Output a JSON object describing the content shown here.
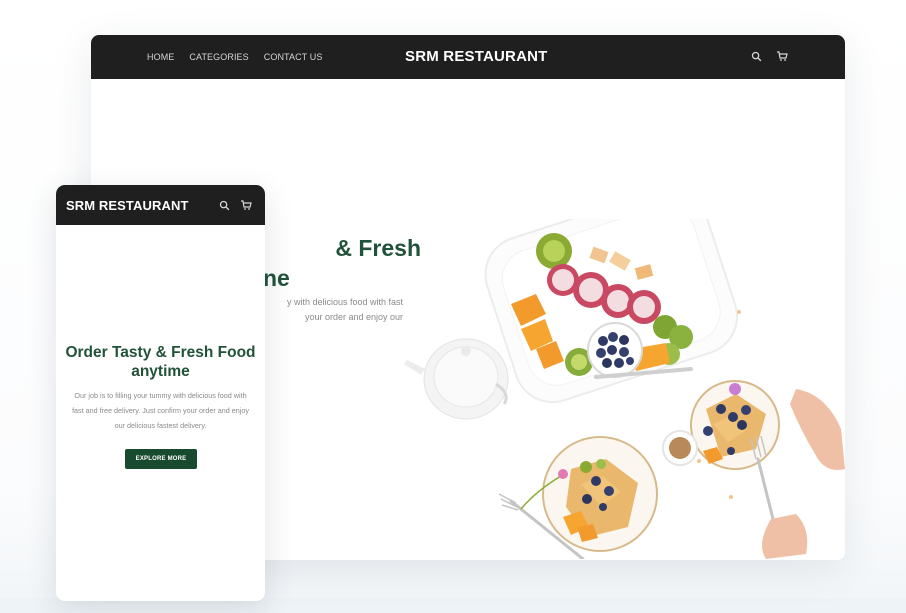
{
  "desktop": {
    "nav": {
      "links": [
        "HOME",
        "CATEGORIES",
        "CONTACT US"
      ],
      "brand": "SRM RESTAURANT",
      "icons": [
        "search-icon",
        "cart-icon"
      ]
    },
    "hero": {
      "title_line1": "& Fresh",
      "title_line2": "ne",
      "subtitle_line1": "y with delicious food with fast",
      "subtitle_line2": "your order and enjoy our"
    }
  },
  "mobile": {
    "nav": {
      "brand": "SRM RESTAURANT",
      "icons": [
        "search-icon",
        "cart-icon"
      ]
    },
    "hero": {
      "title": "Order Tasty & Fresh Food anytime",
      "subtitle": "Our job is to filling your tummy with delicious food with fast and free delivery. Just confirm your order and enjoy our delicious fastest delivery.",
      "button": "EXPLORE MORE"
    }
  },
  "colors": {
    "nav_bg": "#1f1f1f",
    "accent_green": "#21523a",
    "button_green": "#184a2f",
    "muted_text": "#8a8a8a"
  }
}
